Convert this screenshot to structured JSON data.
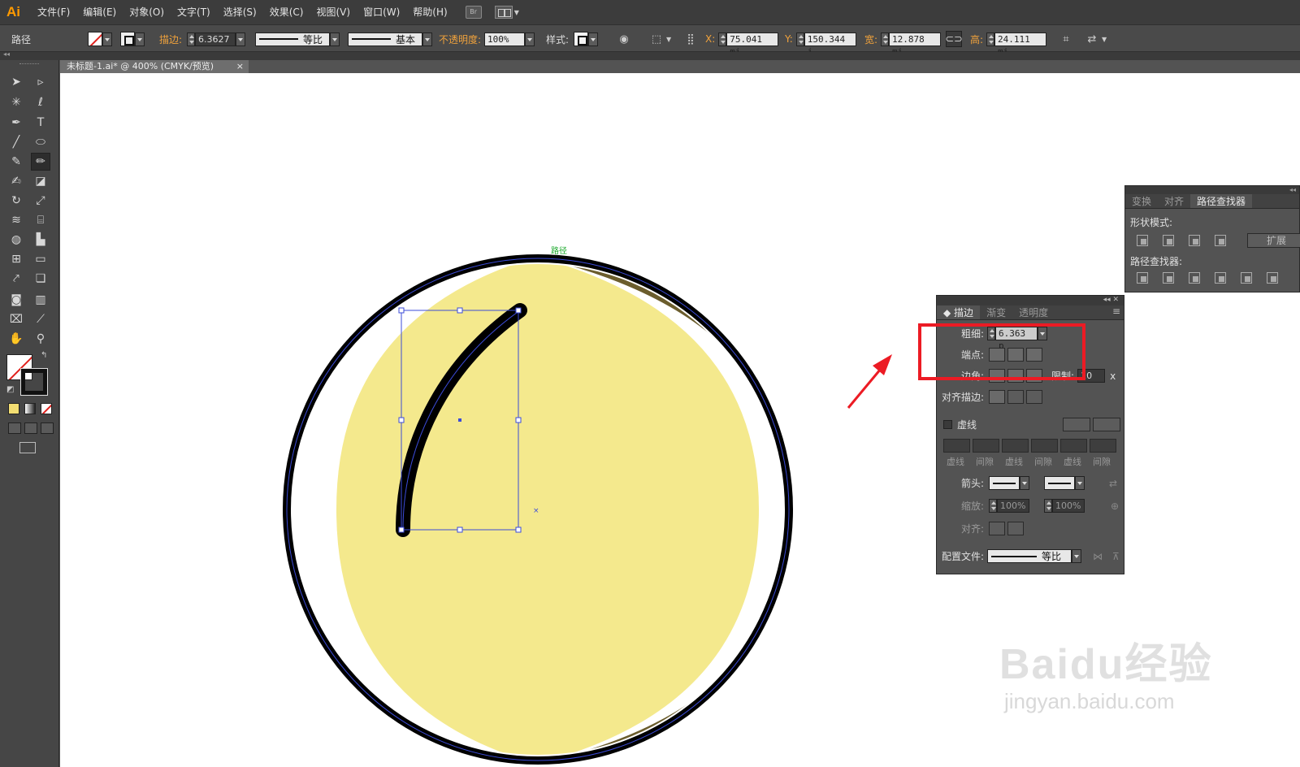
{
  "app": {
    "logo": "Ai"
  },
  "menu": {
    "items": [
      "文件(F)",
      "编辑(E)",
      "对象(O)",
      "文字(T)",
      "选择(S)",
      "效果(C)",
      "视图(V)",
      "窗口(W)",
      "帮助(H)"
    ],
    "bridge_label": "Br"
  },
  "control": {
    "object_type": "路径",
    "stroke_label": "描边:",
    "stroke_value": "6.3627",
    "profile_label": "等比",
    "brush_label": "基本",
    "opacity_label": "不透明度:",
    "opacity_value": "100%",
    "style_label": "样式:",
    "x_label": "X:",
    "x_value": "75.041 mi",
    "y_label": "Y:",
    "y_value": "150.344 i",
    "w_label": "宽:",
    "w_value": "12.878 mi",
    "h_label": "高:",
    "h_value": "24.111 mi"
  },
  "document": {
    "tab_title": "未标题-1.ai* @ 400% (CMYK/预览)",
    "close": "×"
  },
  "canvas": {
    "anchor_hint": "路径",
    "colors": {
      "light_fill": "#f4e98d",
      "shadow_fill": "#6b5d2d",
      "ring": "#000000",
      "guide": "#3b4bd8"
    }
  },
  "pathfinder_panel": {
    "tabs": [
      "变换",
      "对齐",
      "路径查找器"
    ],
    "active_tab": 2,
    "shape_modes_label": "形状模式:",
    "expand_label": "扩展",
    "pathfinders_label": "路径查找器:"
  },
  "stroke_panel": {
    "tabs": [
      "描边",
      "渐变",
      "透明度"
    ],
    "active_tab": 0,
    "weight_label": "粗细:",
    "weight_value": "6.363 p",
    "cap_label": "端点:",
    "corner_label": "边角:",
    "limit_label": "限制:",
    "limit_value": "10",
    "limit_unit": "x",
    "align_label": "对齐描边:",
    "dashed_label": "虚线",
    "dash_labels": [
      "虚线",
      "间隙",
      "虚线",
      "间隙",
      "虚线",
      "间隙"
    ],
    "arrow_label": "箭头:",
    "scale_label": "缩放:",
    "scale_values": [
      "100%",
      "100%"
    ],
    "align2_label": "对齐:",
    "profile_label": "配置文件:",
    "profile_value": "等比"
  },
  "watermark": {
    "brand": "Baidu经验",
    "url": "jingyan.baidu.com"
  }
}
